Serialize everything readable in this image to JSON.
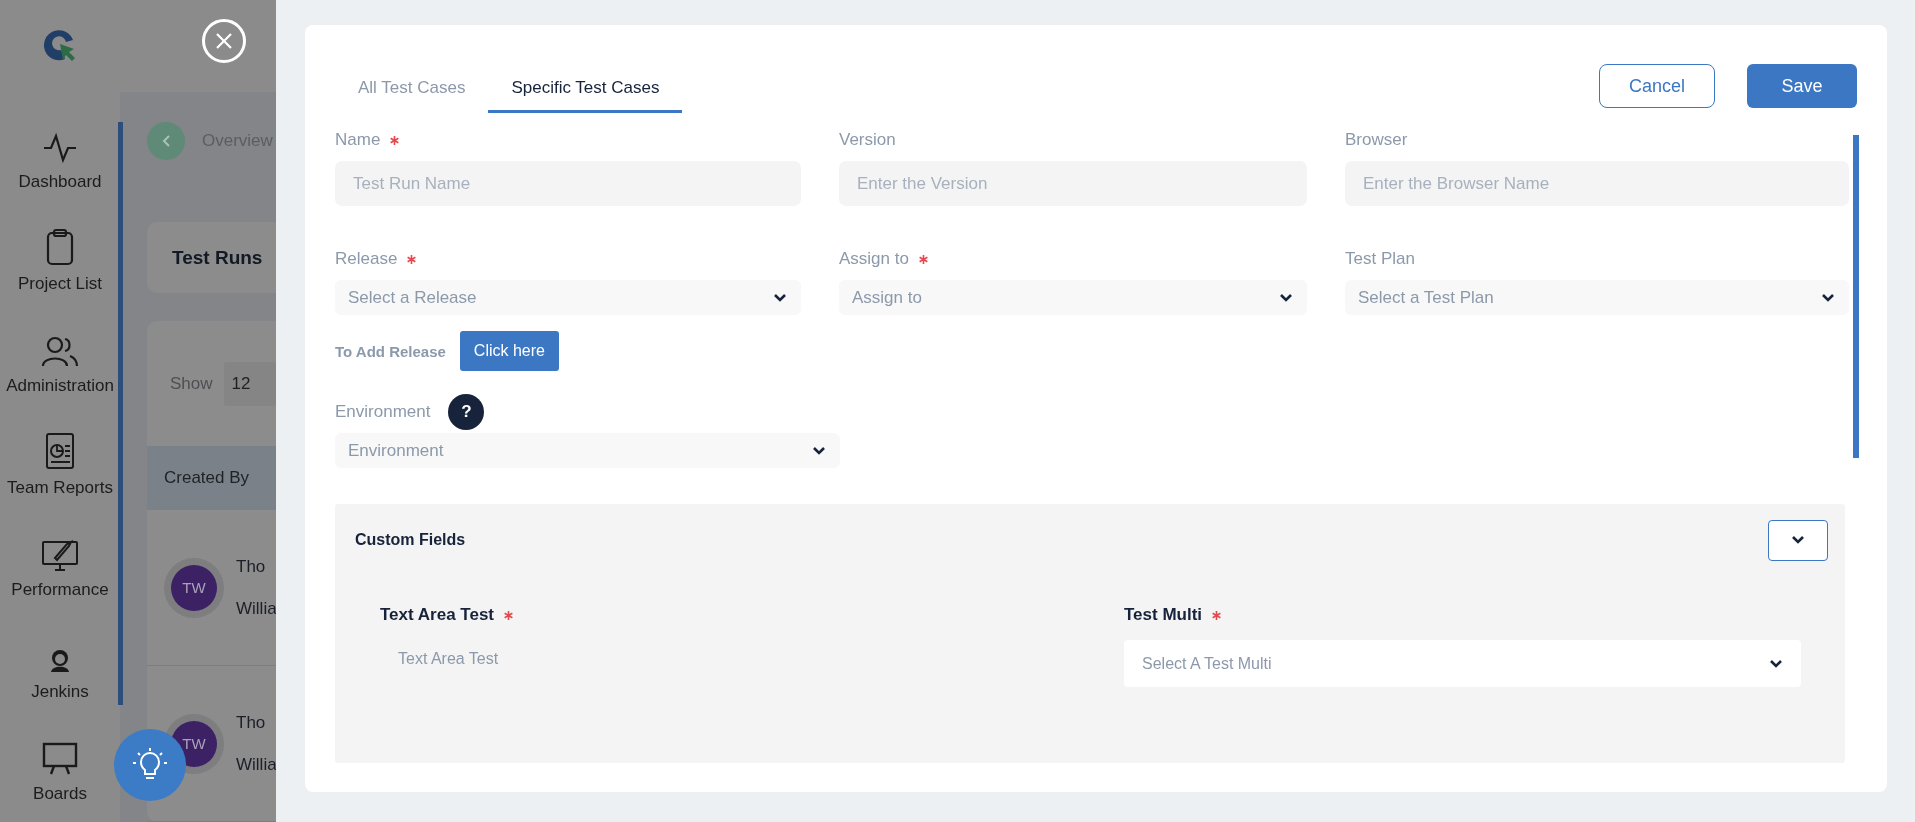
{
  "background": {
    "sidebar": {
      "items": [
        {
          "label": "Dashboard"
        },
        {
          "label": "Project List"
        },
        {
          "label": "Administration"
        },
        {
          "label": "Team Reports"
        },
        {
          "label": "Performance"
        },
        {
          "label": "Jenkins"
        },
        {
          "label": "Boards"
        }
      ]
    },
    "breadcrumb": "Overview",
    "page_title": "Test Runs",
    "show_label": "Show",
    "show_value": "12",
    "column_header": "Created By",
    "rows": [
      {
        "initials": "TW",
        "line_1": "Tho",
        "line_2": "Willia"
      },
      {
        "initials": "TW",
        "line_1": "Tho",
        "line_2": "Willia"
      }
    ]
  },
  "drawer": {
    "tabs": [
      {
        "label": "All Test Cases",
        "selected": false
      },
      {
        "label": "Specific Test Cases",
        "selected": true
      }
    ],
    "cancel": "Cancel",
    "save": "Save",
    "fields": [
      {
        "label": "Name",
        "required": true,
        "kind": "input",
        "placeholder": "Test Run Name"
      },
      {
        "label": "Version",
        "required": false,
        "kind": "input",
        "placeholder": "Enter the Version"
      },
      {
        "label": "Browser",
        "required": false,
        "kind": "input",
        "placeholder": "Enter the Browser Name"
      },
      {
        "label": "Release",
        "required": true,
        "kind": "select",
        "placeholder": "Select a Release"
      },
      {
        "label": "Assign to",
        "required": true,
        "kind": "select",
        "placeholder": "Assign to"
      },
      {
        "label": "Test Plan",
        "required": false,
        "kind": "select",
        "placeholder": "Select a Test Plan"
      }
    ],
    "add_release": {
      "text": "To Add Release",
      "button": "Click here"
    },
    "environment": {
      "label": "Environment",
      "help": "?",
      "placeholder": "Environment"
    },
    "custom_fields": {
      "title": "Custom Fields",
      "expanded": true,
      "fields": [
        {
          "label": "Text Area Test",
          "required": true,
          "kind": "textarea",
          "placeholder": "Text Area Test"
        },
        {
          "label": "Test Multi",
          "required": true,
          "kind": "select",
          "placeholder": "Select A Test  Multi"
        }
      ]
    }
  }
}
